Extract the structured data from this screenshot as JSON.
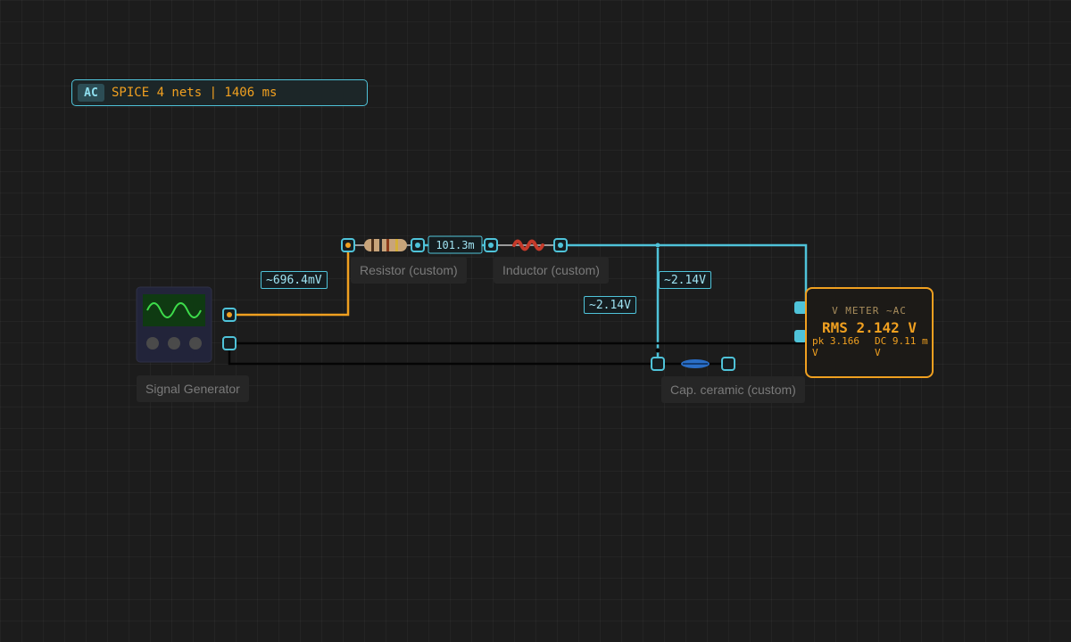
{
  "status_bar": {
    "mode_badge": "AC",
    "summary": "SPICE 4 nets | 1406 ms"
  },
  "components": {
    "signal_generator": {
      "label": "Signal Generator"
    },
    "resistor": {
      "label": "Resistor (custom)",
      "value_tag": "101.3m"
    },
    "inductor": {
      "label": "Inductor (custom)"
    },
    "capacitor": {
      "label": "Cap. ceramic (custom)"
    }
  },
  "voltage_tags": {
    "gen_node": "~696.4mV",
    "cap_node": "~2.14V",
    "cap_node_left": "~2.14V"
  },
  "voltmeter": {
    "title": "V METER ~AC",
    "rms": "RMS 2.142 V",
    "peak": "pk 3.166 V",
    "dc": "DC 9.11 mV"
  },
  "colors": {
    "background": "#1c1c1c",
    "accent_cyan": "#4fc3d9",
    "accent_orange": "#f0a020",
    "scope_green": "#3ddc4a"
  }
}
